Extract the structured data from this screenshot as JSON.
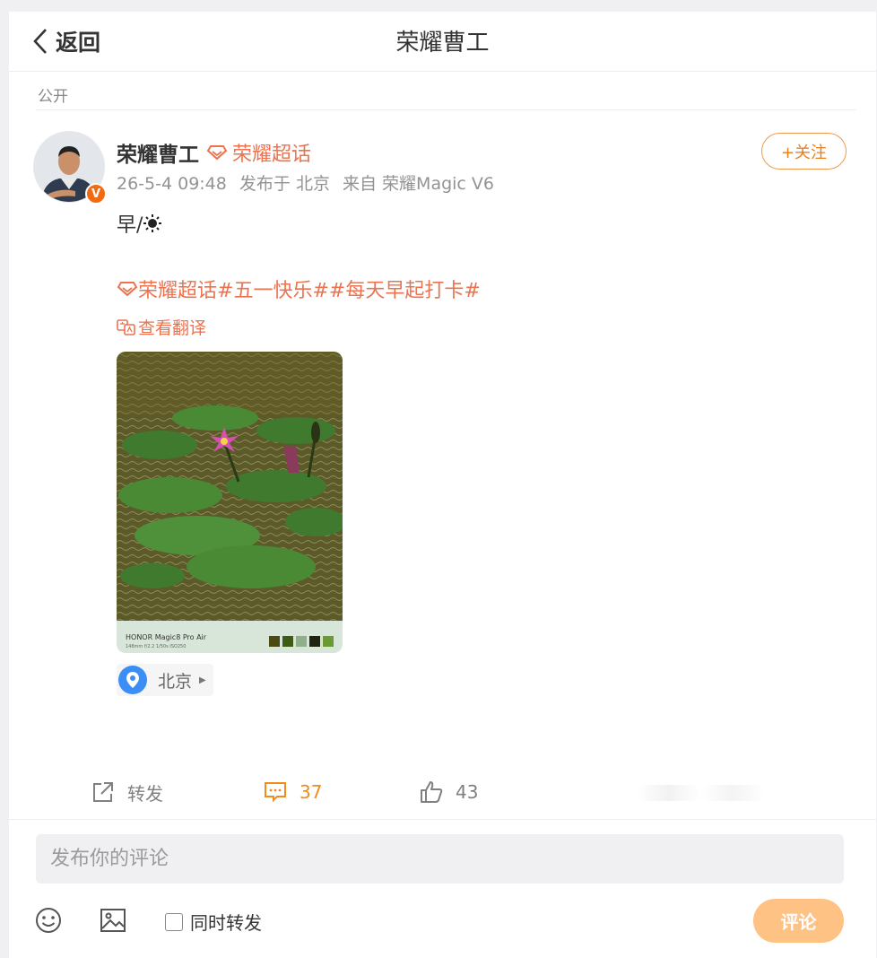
{
  "header": {
    "back_label": "返回",
    "title": "荣耀曹工"
  },
  "post": {
    "visibility": "公开",
    "author": {
      "name": "荣耀曹工",
      "supertopic": "荣耀超话",
      "verified_badge": "V"
    },
    "follow_label": "+关注",
    "meta": {
      "time": "26-5-4 09:48",
      "published_in": "发布于 北京",
      "source": "来自 荣耀Magic V6"
    },
    "text": "早/",
    "text_icon": "sun-icon",
    "tags": [
      "荣耀超话",
      "#五一快乐#",
      "#每天早起打卡#"
    ],
    "translate_label": "查看翻译",
    "image": {
      "description_icon": "water-lily-photo",
      "watermark_brand": "HONOR Magic8 Pro Air",
      "watermark_params": "148mm  f/2.2  1/50s  ISO250",
      "swatches": [
        "#4a4a12",
        "#3f5a16",
        "#8fae8a",
        "#1e2410",
        "#6a9a32"
      ]
    },
    "location": "北京"
  },
  "actions": {
    "repost_label": "转发",
    "comment_count": "37",
    "like_count": "43"
  },
  "composer": {
    "placeholder": "发布你的评论",
    "sync_repost_label": "同时转发",
    "submit_label": "评论"
  },
  "colors": {
    "accent": "#eb7350",
    "comment_orange": "#f28a1c",
    "submit_bg": "#ffc285"
  }
}
